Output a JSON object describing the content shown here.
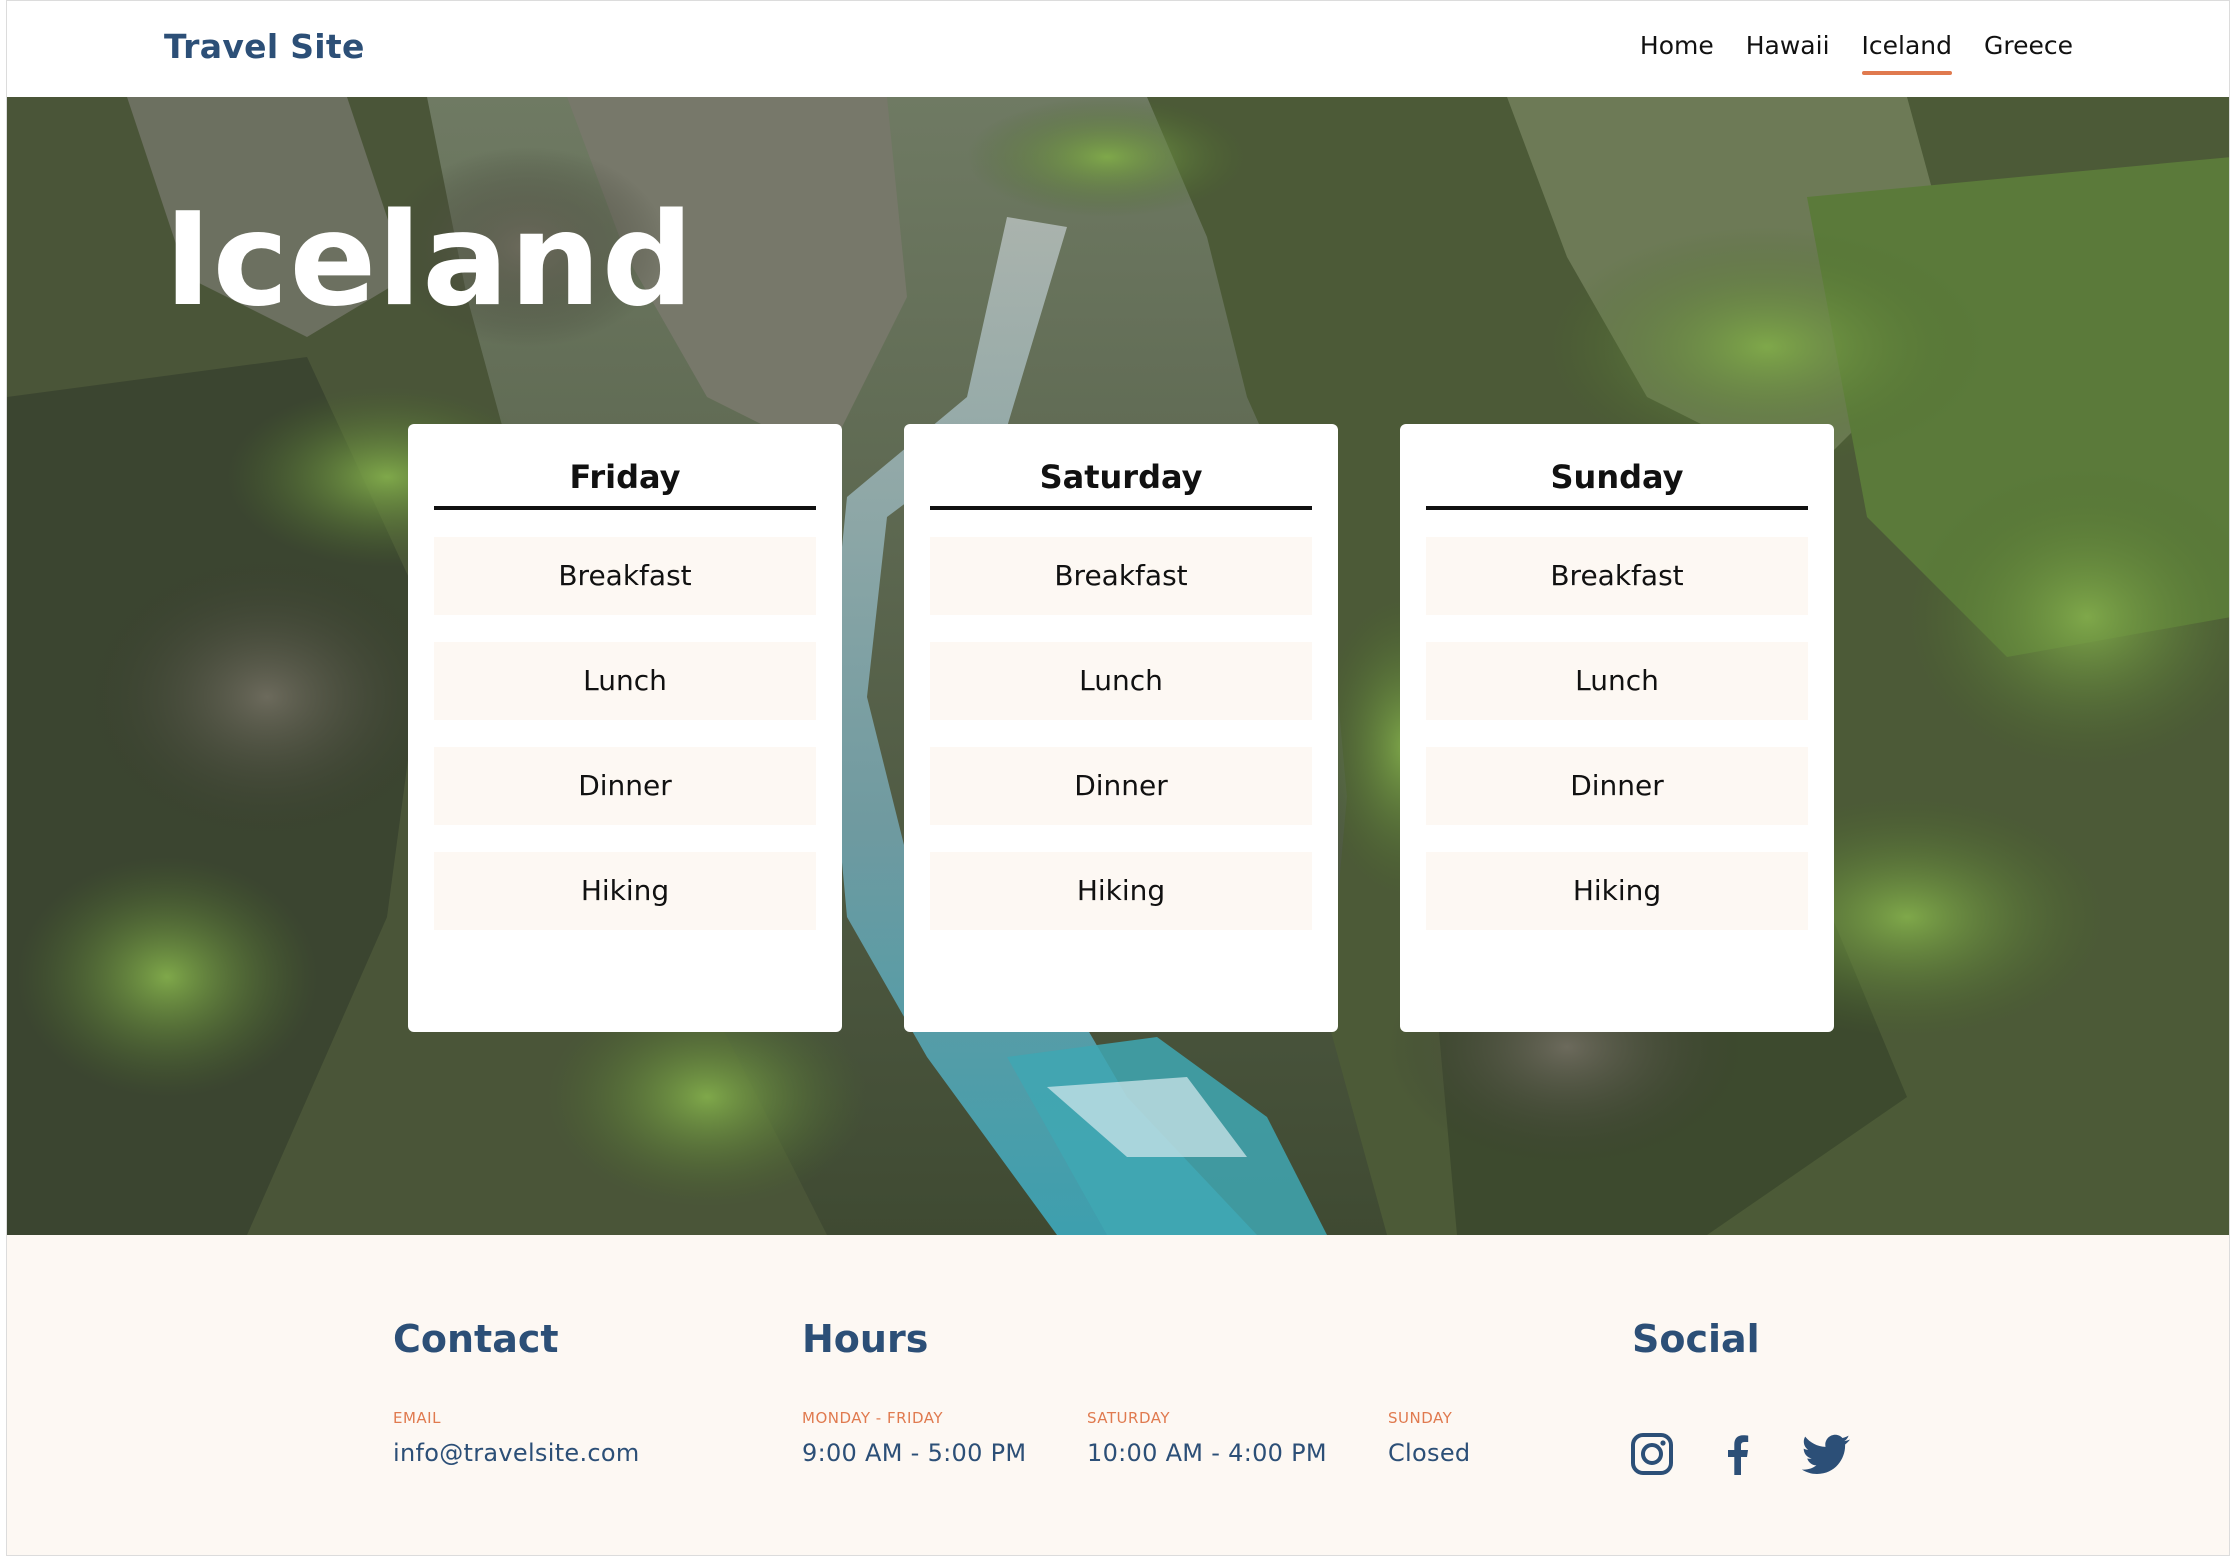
{
  "header": {
    "brand": "Travel Site",
    "nav": [
      {
        "label": "Home",
        "active": false
      },
      {
        "label": "Hawaii",
        "active": false
      },
      {
        "label": "Iceland",
        "active": true
      },
      {
        "label": "Greece",
        "active": false
      }
    ]
  },
  "hero": {
    "title": "Iceland",
    "image": "mossy-canyon-river-photo",
    "days": [
      {
        "title": "Friday",
        "activities": [
          "Breakfast",
          "Lunch",
          "Dinner",
          "Hiking"
        ]
      },
      {
        "title": "Saturday",
        "activities": [
          "Breakfast",
          "Lunch",
          "Dinner",
          "Hiking"
        ]
      },
      {
        "title": "Sunday",
        "activities": [
          "Breakfast",
          "Lunch",
          "Dinner",
          "Hiking"
        ]
      }
    ]
  },
  "footer": {
    "contact": {
      "heading": "Contact",
      "email_label": "EMAIL",
      "email": "info@travelsite.com"
    },
    "hours": {
      "heading": "Hours",
      "weekday_label": "MONDAY - FRIDAY",
      "weekday_value": "9:00 AM - 5:00 PM",
      "saturday_label": "SATURDAY",
      "saturday_value": "10:00 AM - 4:00 PM",
      "sunday_label": "SUNDAY",
      "sunday_value": "Closed"
    },
    "social": {
      "heading": "Social",
      "icons": [
        "instagram-icon",
        "facebook-icon",
        "twitter-icon"
      ]
    }
  },
  "colors": {
    "brand_blue": "#2c4f77",
    "accent_orange": "#e07a4f",
    "cream": "#fdf8f3"
  }
}
